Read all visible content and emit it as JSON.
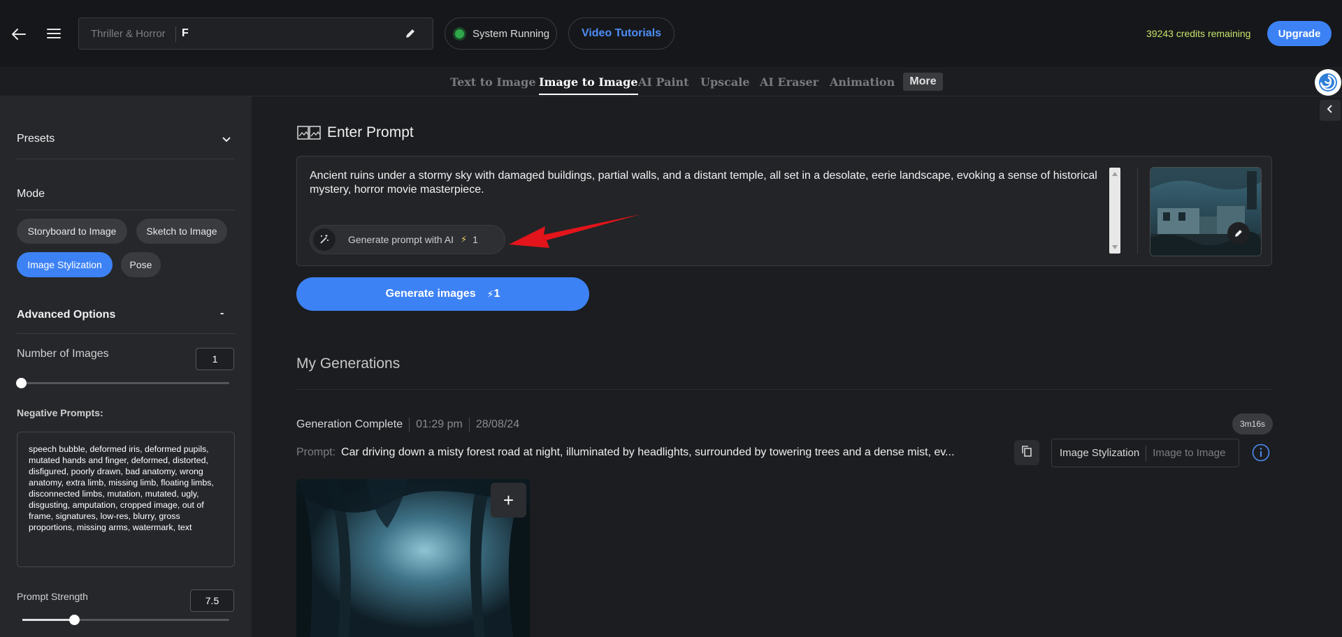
{
  "header": {
    "project_genre": "Thriller & Horror",
    "project_name": "F",
    "status": "System Running",
    "tutorials": "Video Tutorials",
    "credits": "39243 credits remaining",
    "upgrade": "Upgrade"
  },
  "tabs": [
    {
      "label": "Text to Image"
    },
    {
      "label": "Image to Image"
    },
    {
      "label": "AI Paint"
    },
    {
      "label": "Upscale"
    },
    {
      "label": "AI Eraser"
    },
    {
      "label": "Animation"
    }
  ],
  "more": "More",
  "active_tab": "Image to Image",
  "sidebar": {
    "presets": "Presets",
    "mode": "Mode",
    "modes": [
      "Storyboard to Image",
      "Sketch to Image",
      "Image Stylization",
      "Pose"
    ],
    "active_mode": "Image Stylization",
    "advanced": "Advanced Options",
    "advanced_toggle": "-",
    "num_images_label": "Number of Images",
    "num_images": "1",
    "num_images_level": 0,
    "negative_label": "Negative Prompts:",
    "negative_text": "speech bubble, deformed iris, deformed pupils, mutated hands and finger, deformed, distorted, disfigured, poorly drawn, bad anatomy, wrong anatomy, extra limb, missing limb, floating limbs, disconnected limbs, mutation, mutated, ugly, disgusting, amputation, cropped image, out of frame, signatures, low-res, blurry, gross proportions, missing arms, watermark, text",
    "strength_label": "Prompt Strength",
    "strength": "7.5",
    "strength_level": 0.25
  },
  "main": {
    "enter_prompt": "Enter Prompt",
    "prompt_text": "Ancient ruins under a stormy sky with damaged buildings, partial walls, and a distant temple, all set in a desolate, eerie landscape, evoking a sense of historical mystery, horror movie masterpiece.",
    "gen_ai_label": "Generate prompt with AI",
    "gen_ai_cost": "1",
    "generate_label": "Generate images",
    "generate_cost": "1",
    "my_generations": "My Generations",
    "generation": {
      "status": "Generation Complete",
      "time": "01:29 pm",
      "date": "28/08/24",
      "duration": "3m16s",
      "prompt_label": "Prompt:",
      "prompt": "Car driving down a misty forest road at night, illuminated by headlights, surrounded by towering trees and a dense mist, ev...",
      "mode": "Image Stylization",
      "tool": "Image to Image"
    }
  },
  "colors": {
    "accent": "#3d82f5",
    "credits": "#c7e36b",
    "status_green": "#2ea84a",
    "arrow": "#e3141b"
  }
}
